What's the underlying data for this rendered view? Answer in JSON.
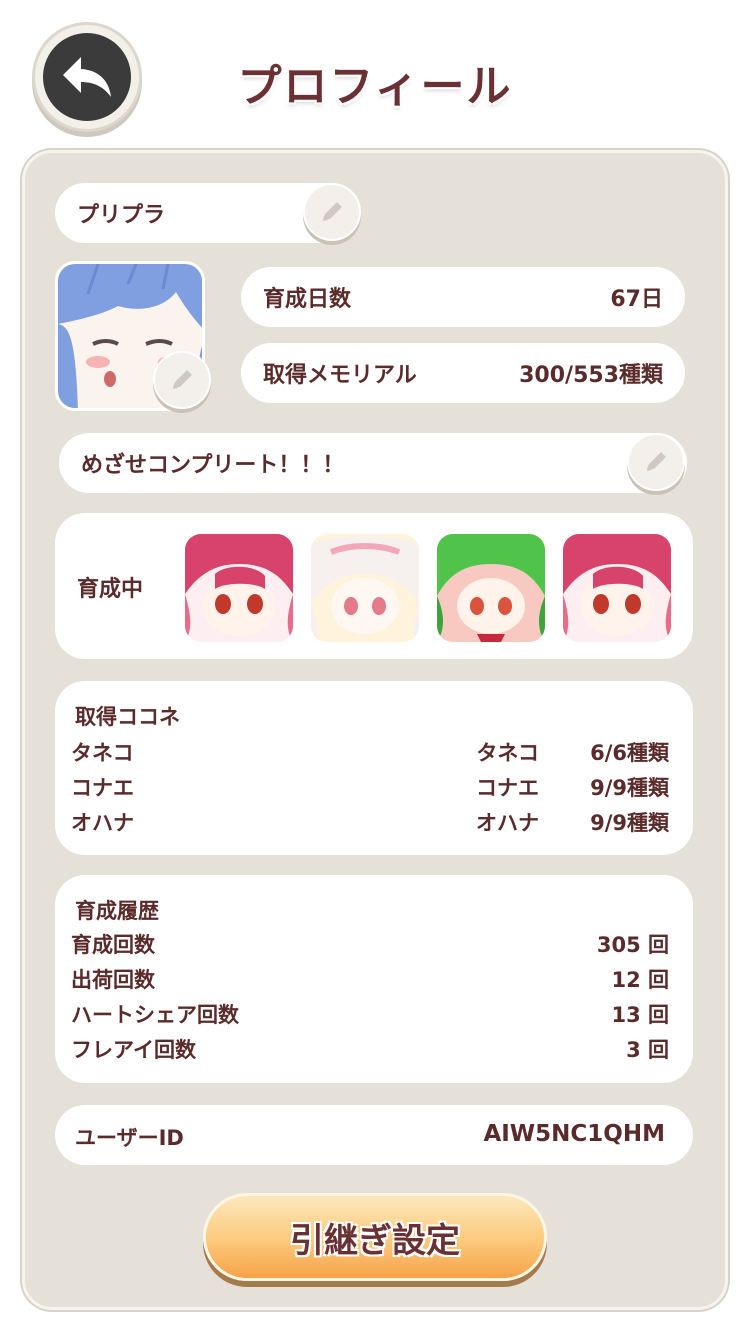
{
  "header": {
    "title": "プロフィール",
    "back_icon": "back-arrow-icon"
  },
  "profile": {
    "name": "プリプラ",
    "stats": [
      {
        "label": "育成日数",
        "value": "67日"
      },
      {
        "label": "取得メモリアル",
        "value": "300/553種類"
      }
    ],
    "motto": "めざせコンプリート！！！"
  },
  "raising": {
    "label": "育成中",
    "characters": [
      "chara-red-hair",
      "chara-white-hair",
      "chara-green-hair",
      "chara-red-hair"
    ]
  },
  "kokone": {
    "title": "取得ココネ",
    "rows": [
      {
        "label": "タネコ",
        "name": "タネコ",
        "count": "6/6種類"
      },
      {
        "label": "コナエ",
        "name": "コナエ",
        "count": "9/9種類"
      },
      {
        "label": "オハナ",
        "name": "オハナ",
        "count": "9/9種類"
      }
    ]
  },
  "history": {
    "title": "育成履歴",
    "rows": [
      {
        "label": "育成回数",
        "value": "305 回"
      },
      {
        "label": "出荷回数",
        "value": "12 回"
      },
      {
        "label": "ハートシェア回数",
        "value": "13 回"
      },
      {
        "label": "フレアイ回数",
        "value": "3 回"
      }
    ]
  },
  "user": {
    "label": "ユーザーID",
    "id": "AIW5NC1QHM"
  },
  "transfer": {
    "label": "引継ぎ設定"
  },
  "colors": {
    "text": "#5b2a2a",
    "panel": "#e5e0d8",
    "button": "#fbc97a"
  }
}
